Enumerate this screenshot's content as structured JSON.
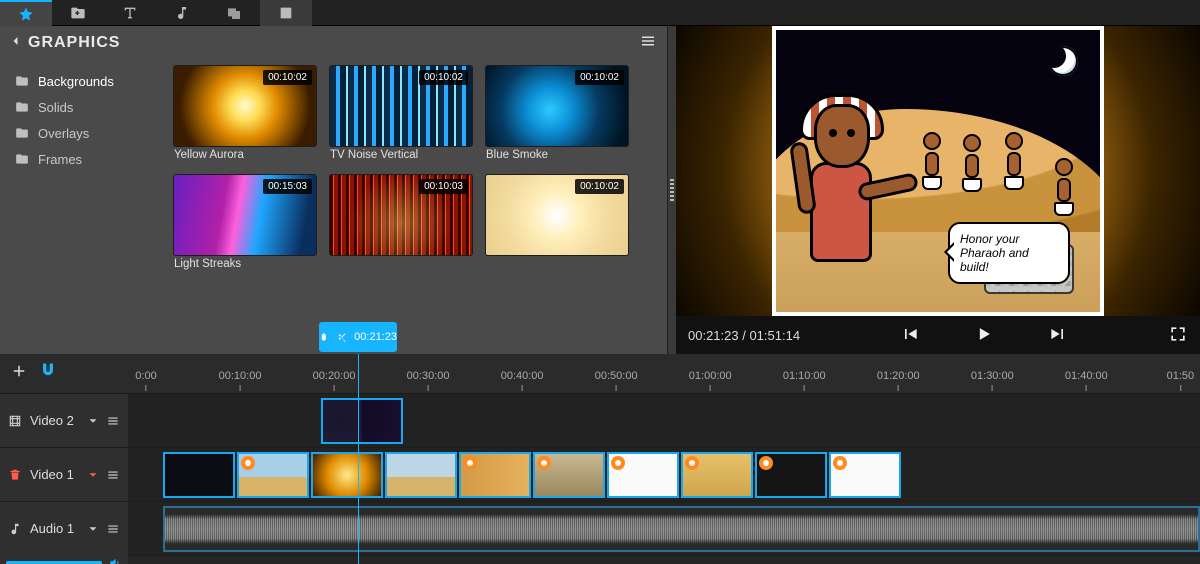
{
  "library": {
    "title": "GRAPHICS",
    "categories": [
      {
        "label": "Backgrounds",
        "active": true
      },
      {
        "label": "Solids",
        "active": false
      },
      {
        "label": "Overlays",
        "active": false
      },
      {
        "label": "Frames",
        "active": false
      }
    ],
    "items": [
      {
        "name": "Yellow Aurora",
        "duration": "00:10:02",
        "thumb": "th-yellow"
      },
      {
        "name": "TV Noise Vertical",
        "duration": "00:10:02",
        "thumb": "th-tv"
      },
      {
        "name": "Blue Smoke",
        "duration": "00:10:02",
        "thumb": "th-smoke"
      },
      {
        "name": "Light Streaks",
        "duration": "00:15:03",
        "thumb": "th-streak"
      },
      {
        "name": "",
        "duration": "00:10:03",
        "thumb": "th-red"
      },
      {
        "name": "",
        "duration": "00:10:02",
        "thumb": "th-white"
      }
    ]
  },
  "preview": {
    "speech_text": "Honor your Pharaoh and build!",
    "current_time": "00:21:23",
    "total_time": "01:51:14",
    "time_sep": " / "
  },
  "timeline": {
    "ruler": [
      "0:00",
      "00:10:00",
      "00:20:00",
      "00:30:00",
      "00:40:00",
      "00:50:00",
      "01:00:00",
      "01:10:00",
      "01:20:00",
      "01:30:00",
      "01:40:00",
      "01:50"
    ],
    "playhead_time": "00:21:23",
    "tracks": {
      "video2": {
        "label": "Video 2"
      },
      "video1": {
        "label": "Video 1"
      },
      "audio1": {
        "label": "Audio 1"
      }
    }
  }
}
